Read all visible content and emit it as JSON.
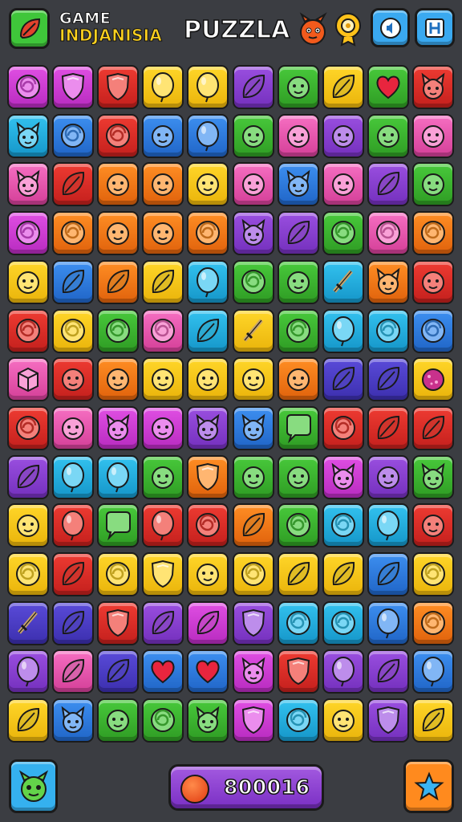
{
  "header": {
    "title_line1": "GAME",
    "title_line2": "INDJANISIA",
    "title_main": "PUZZLA"
  },
  "footer": {
    "score": "800016"
  },
  "colors": {
    "background": "#3b3d42",
    "menu_button": "#3fc63a",
    "settings_button": "#3aa9f0",
    "score_pill": "#8e3fd6",
    "action_button": "#ff8a1e"
  },
  "board": {
    "columns": 10,
    "rows": 14,
    "tiles": [
      [
        "magenta:swirl",
        "magenta:shield",
        "red:shield",
        "yellow:balloon",
        "yellow:balloon",
        "purple:leaf",
        "green:face",
        "yellow:leaf",
        "green:heart",
        "red:cat"
      ],
      [
        "cyan:cat",
        "blue:swirl",
        "red:swirl",
        "blue:face",
        "blue:balloon",
        "green:face",
        "pink:face",
        "purple:face",
        "green:face",
        "pink:face"
      ],
      [
        "pink:cat",
        "red:leaf",
        "orange:face",
        "orange:face",
        "yellow:face",
        "pink:face",
        "blue:cat",
        "pink:face",
        "purple:leaf",
        "green:face"
      ],
      [
        "magenta:swirl",
        "orange:swirl",
        "orange:face",
        "orange:face",
        "orange:swirl",
        "purple:cat",
        "purple:leaf",
        "green:swirl",
        "pink:swirl",
        "orange:swirl"
      ],
      [
        "yellow:face",
        "blue:leaf",
        "orange:leaf",
        "yellow:leaf",
        "cyan:balloon",
        "green:swirl",
        "green:face",
        "cyan:sword",
        "orange:cat",
        "red:face"
      ],
      [
        "red:swirl",
        "yellow:swirl",
        "green:swirl",
        "pink:swirl",
        "cyan:leaf",
        "yellow:sword",
        "green:swirl",
        "cyan:balloon",
        "cyan:swirl",
        "blue:swirl"
      ],
      [
        "pink:box",
        "red:face",
        "orange:face",
        "yellow:face",
        "yellow:face",
        "yellow:face",
        "orange:face",
        "indigo:leaf",
        "indigo:leaf",
        "yellow:blob"
      ],
      [
        "red:swirl",
        "pink:face",
        "magenta:cat",
        "magenta:face",
        "purple:cat",
        "blue:cat",
        "green:bubble",
        "red:swirl",
        "red:leaf",
        "red:leaf"
      ],
      [
        "purple:leaf",
        "cyan:balloon",
        "cyan:balloon",
        "green:face",
        "orange:shield",
        "green:face",
        "green:face",
        "magenta:cat",
        "purple:face",
        "green:cat"
      ],
      [
        "yellow:face",
        "red:balloon",
        "green:bubble",
        "red:balloon",
        "red:swirl",
        "orange:leaf",
        "green:swirl",
        "cyan:swirl",
        "cyan:balloon",
        "red:face"
      ],
      [
        "yellow:swirl",
        "red:leaf",
        "yellow:swirl",
        "yellow:shield",
        "yellow:face",
        "yellow:swirl",
        "yellow:leaf",
        "yellow:leaf",
        "blue:leaf",
        "yellow:swirl"
      ],
      [
        "indigo:sword",
        "indigo:leaf",
        "red:shield",
        "purple:leaf",
        "magenta:leaf",
        "purple:shield",
        "cyan:swirl",
        "cyan:swirl",
        "blue:balloon",
        "orange:swirl"
      ],
      [
        "purple:balloon",
        "pink:leaf",
        "indigo:leaf",
        "blue:heart",
        "blue:heart",
        "magenta:cat",
        "red:shield",
        "purple:balloon",
        "purple:leaf",
        "blue:balloon"
      ],
      [
        "yellow:leaf",
        "blue:cat",
        "green:face",
        "green:swirl",
        "green:cat",
        "magenta:shield",
        "cyan:swirl",
        "yellow:face",
        "purple:shield",
        "yellow:leaf"
      ]
    ]
  }
}
